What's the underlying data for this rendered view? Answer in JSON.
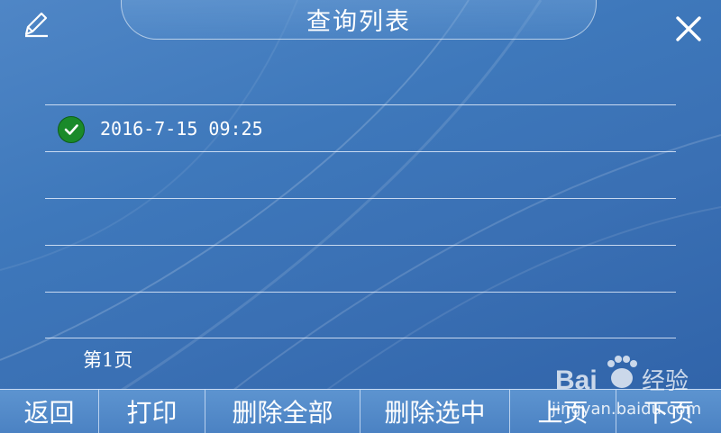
{
  "header": {
    "title": "查询列表"
  },
  "icons": {
    "edit": "edit-icon",
    "close": "close-icon",
    "check": "check-icon"
  },
  "list": {
    "rows": [
      {
        "text": "2016-7-15 09:25",
        "checked": true
      },
      {
        "text": ""
      },
      {
        "text": ""
      },
      {
        "text": ""
      },
      {
        "text": ""
      }
    ]
  },
  "pager": {
    "label": "第1页"
  },
  "toolbar": {
    "back": "返回",
    "print": "打印",
    "delete_all": "删除全部",
    "delete_selected": "删除选中",
    "prev_page": "上页",
    "next_page": "下页"
  },
  "watermark": {
    "brand": "Bai",
    "brand_tail": "经验",
    "url": "jingyan.baidu.com"
  },
  "colors": {
    "background": "#3e78bb",
    "check_green": "#1a8a2a",
    "toolbar": "#5d94d0"
  }
}
